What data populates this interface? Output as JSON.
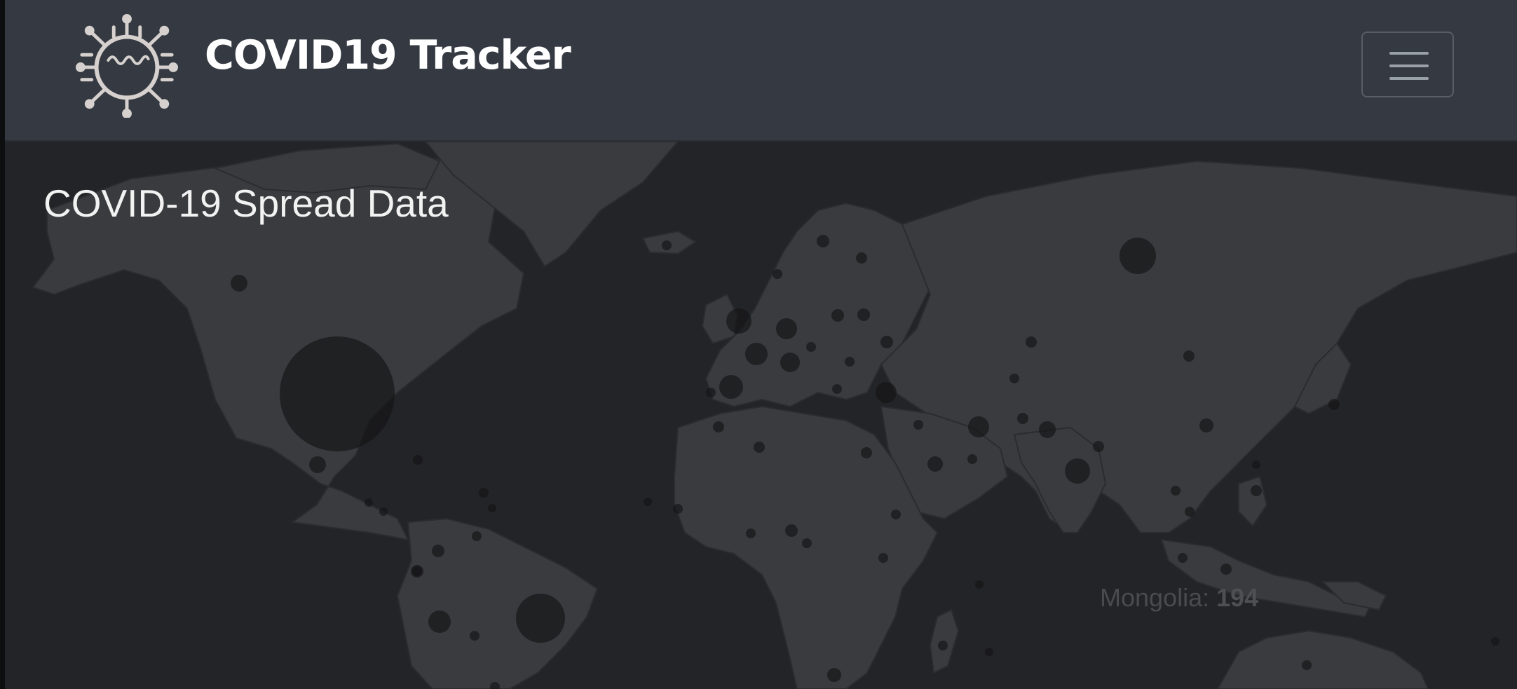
{
  "navbar": {
    "brand": "COVID19 Tracker",
    "logo_icon": "virus-icon",
    "menu_icon": "hamburger-icon"
  },
  "map": {
    "heading": "COVID-19 Spread Data",
    "tooltip": {
      "country": "Mongolia",
      "value": "194"
    },
    "colors": {
      "background": "#232427",
      "land": "#3a3b3e",
      "bubble": "#141416",
      "navbar": "#353a42"
    }
  }
}
